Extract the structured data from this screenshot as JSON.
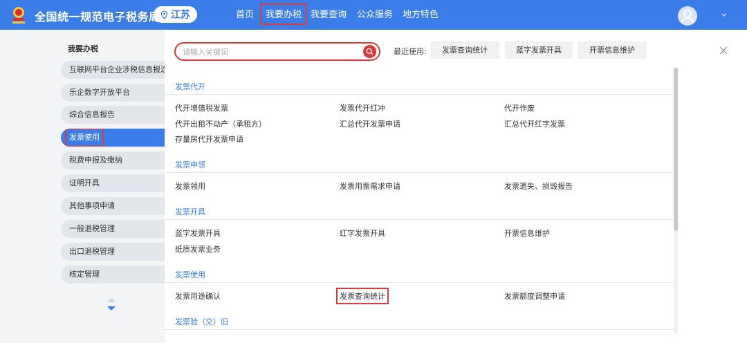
{
  "header": {
    "title": "全国统一规范电子税务局",
    "region": "江苏",
    "nav": [
      "首页",
      "我要办税",
      "我要查询",
      "公众服务",
      "地方特色"
    ],
    "brand_color": "#3b7de8"
  },
  "sidebar": {
    "title": "我要办税",
    "items": [
      "互联网平台企业涉税信息报送",
      "乐企数字开放平台",
      "综合信息报告",
      "发票使用",
      "税费申报及缴纳",
      "证明开具",
      "其他事项申请",
      "一般退税管理",
      "出口退税管理",
      "核定管理"
    ],
    "active_index": 3
  },
  "search": {
    "placeholder": "请输入关键词"
  },
  "recent": {
    "label": "最近使用:",
    "items": [
      "发票查询统计",
      "蓝字发票开具",
      "开票信息维护"
    ]
  },
  "sections": [
    {
      "title": "发票代开",
      "rows": [
        [
          "代开增值税发票",
          "发票代开红冲",
          "代开作废"
        ],
        [
          "代开出租不动产（承租方）",
          "汇总代开发票申请",
          "汇总代开红字发票"
        ],
        [
          "存量房代开发票申请"
        ]
      ]
    },
    {
      "title": "发票申领",
      "rows": [
        [
          "发票领用",
          "发票用票需求申请",
          "发票遗失、损毁报告"
        ]
      ]
    },
    {
      "title": "发票开具",
      "rows": [
        [
          "蓝字发票开具",
          "红字发票开具",
          "开票信息维护"
        ],
        [
          "纸质发票业务"
        ]
      ]
    },
    {
      "title": "发票使用",
      "rows": [
        [
          "发票用途确认",
          "发票查询统计",
          "发票额度调整申请"
        ]
      ]
    },
    {
      "title": "发票验（交）旧",
      "rows": []
    }
  ],
  "icons": {
    "logo": "tax-emblem-icon",
    "region": "location-pin-icon",
    "search": "search-icon",
    "avatar": "user-avatar-icon",
    "close": "close-icon"
  }
}
